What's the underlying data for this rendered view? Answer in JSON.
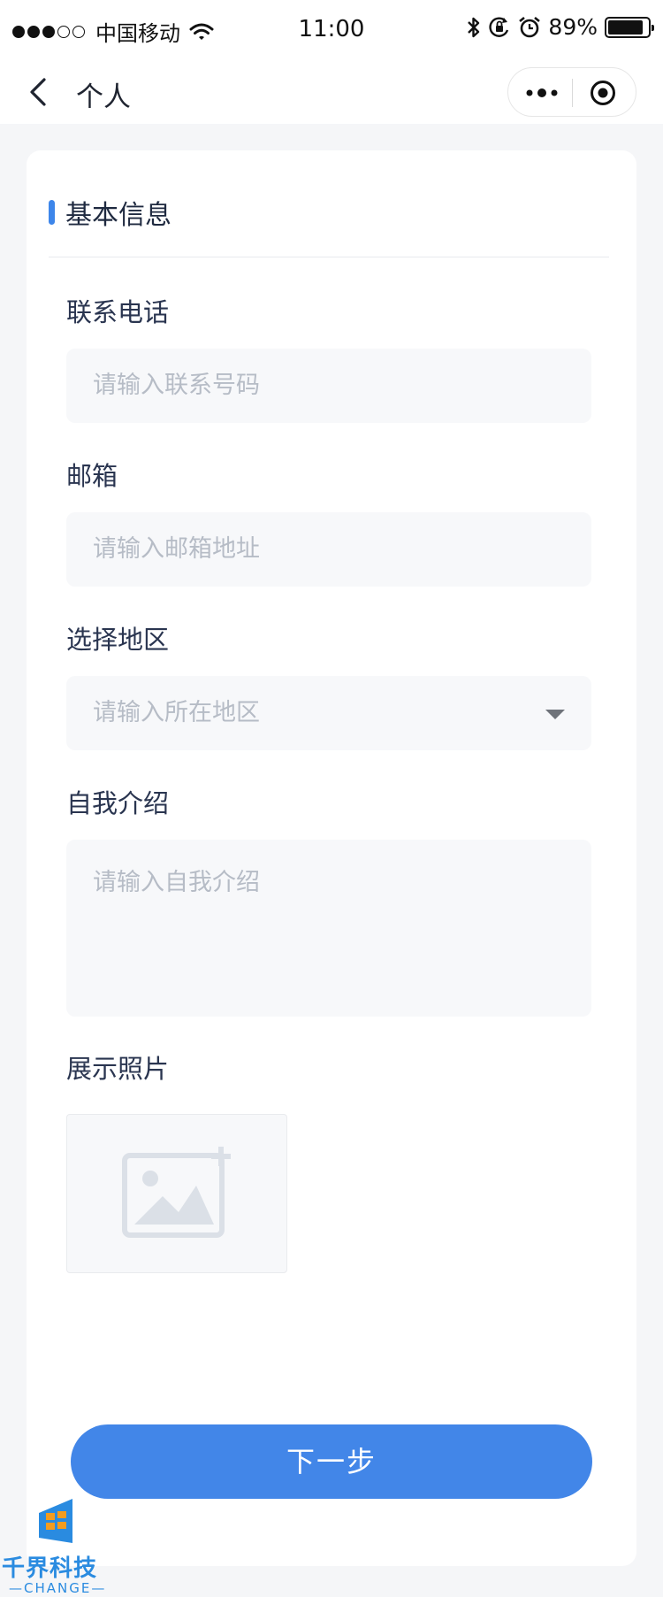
{
  "status_bar": {
    "carrier": "中国移动",
    "time": "11:00",
    "battery": "89%",
    "battery_level": 0.89
  },
  "nav": {
    "title": "个人"
  },
  "section": {
    "title": "基本信息"
  },
  "form": {
    "phone": {
      "label": "联系电话",
      "placeholder": "请输入联系号码"
    },
    "email": {
      "label": "邮箱",
      "placeholder": "请输入邮箱地址"
    },
    "region": {
      "label": "选择地区",
      "placeholder": "请输入所在地区"
    },
    "intro": {
      "label": "自我介绍",
      "placeholder": "请输入自我介绍"
    },
    "photo": {
      "label": "展示照片"
    }
  },
  "actions": {
    "next_label": "下一步"
  },
  "watermark": {
    "brand": "千界科技",
    "sub": "—CHANGE—"
  },
  "colors": {
    "accent": "#4286e8",
    "field_bg": "#f7f8fa",
    "placeholder": "#b6bcc6"
  }
}
